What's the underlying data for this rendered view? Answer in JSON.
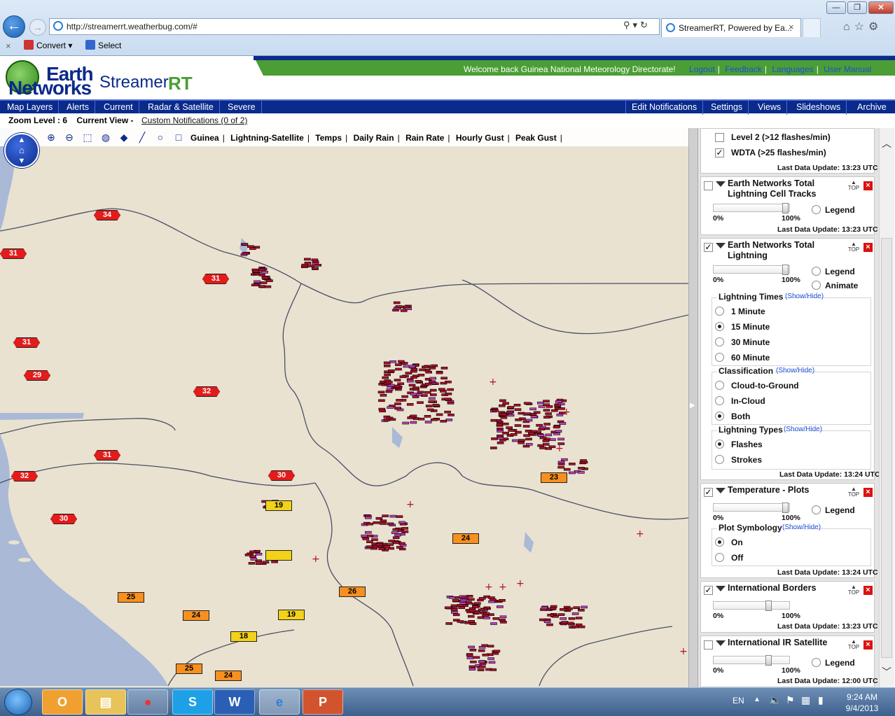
{
  "browser": {
    "url": "http://streamerrt.weatherbug.com/#",
    "tab_title": "StreamerRT, Powered by Ea...",
    "tab_close": "×",
    "cmd_close": "×",
    "convert_label": "Convert",
    "select_label": "Select",
    "window_buttons": [
      "—",
      "❐",
      "✕"
    ]
  },
  "header": {
    "logo_line1": "Earth",
    "logo_line2": "Networks",
    "logo_streamer": "Streamer",
    "logo_rt": "RT",
    "welcome": "Welcome back  Guinea National Meteorology Directorate!",
    "links": [
      "Logout",
      "Feedback",
      "Languages",
      "User Manual"
    ],
    "link_sep": "|"
  },
  "nav": {
    "left": [
      "Map Layers",
      "Alerts",
      "Current",
      "Radar & Satellite",
      "Severe"
    ],
    "right": [
      "Edit Notifications",
      "Settings",
      "Views",
      "Slideshows",
      "Archive"
    ]
  },
  "subnav": {
    "zoom_label": "Zoom Level : 6",
    "view_label": "Current View -",
    "custom_notifications": "Custom Notifications (0 of 2)"
  },
  "map": {
    "view_links": [
      "Guinea",
      "Lightning-Satellite",
      "Temps",
      "Daily Rain",
      "Rain Rate",
      "Hourly Gust",
      "Peak Gust"
    ],
    "view_sep": "|",
    "pan_up": "▲",
    "pan_down": "▼",
    "pan_home": "⌂",
    "temps": [
      {
        "v": "34",
        "c": "red"
      },
      {
        "v": "31",
        "c": "red"
      },
      {
        "v": "31",
        "c": "red"
      },
      {
        "v": "31",
        "c": "red"
      },
      {
        "v": "29",
        "c": "red"
      },
      {
        "v": "32",
        "c": "red"
      },
      {
        "v": "31",
        "c": "red"
      },
      {
        "v": "32",
        "c": "red"
      },
      {
        "v": "30",
        "c": "red"
      },
      {
        "v": "30",
        "c": "red"
      },
      {
        "v": "19",
        "c": "yellow"
      },
      {
        "v": "23",
        "c": "orange"
      },
      {
        "v": "24",
        "c": "orange"
      },
      {
        "v": "26",
        "c": "orange"
      },
      {
        "v": "25",
        "c": "orange"
      },
      {
        "v": "24",
        "c": "orange"
      },
      {
        "v": "19",
        "c": "yellow"
      },
      {
        "v": "18",
        "c": "yellow"
      },
      {
        "v": "25",
        "c": "orange"
      },
      {
        "v": "24",
        "c": "orange"
      },
      {
        "v": "",
        "c": "yellow"
      }
    ]
  },
  "panel": {
    "wdta": {
      "level2": "Level 2 (>12 flashes/min)",
      "wdta": "WDTA (>25 flashes/min)",
      "update": "Last Data Update:  13:23 UTC"
    },
    "cell_tracks": {
      "title1": "Earth Networks Total",
      "title2": "Lightning Cell Tracks",
      "top": "TOP",
      "x": "×",
      "pct0": "0%",
      "pct100": "100%",
      "legend": "Legend",
      "update": "Last Data Update:  13:23 UTC"
    },
    "lightning": {
      "title1": "Earth Networks Total",
      "title2": "Lightning",
      "top": "TOP",
      "x": "×",
      "pct0": "0%",
      "pct100": "100%",
      "legend": "Legend",
      "animate": "Animate",
      "times_label": "Lightning Times",
      "class_label": "Classification",
      "types_label": "Lightning Types",
      "showhide": "(Show/Hide)",
      "times": [
        "1 Minute",
        "15 Minute",
        "30 Minute",
        "60 Minute"
      ],
      "classes": [
        "Cloud-to-Ground",
        "In-Cloud",
        "Both"
      ],
      "types": [
        "Flashes",
        "Strokes"
      ],
      "update": "Last Data Update:  13:24 UTC"
    },
    "temp": {
      "title": "Temperature - Plots",
      "top": "TOP",
      "x": "×",
      "pct0": "0%",
      "pct100": "100%",
      "legend": "Legend",
      "symb_label": "Plot Symbology",
      "showhide": "(Show/Hide)",
      "on": "On",
      "off": "Off",
      "update": "Last Data Update:  13:24 UTC"
    },
    "borders": {
      "title": "International Borders",
      "top": "TOP",
      "x": "×",
      "pct0": "0%",
      "pct100": "100%",
      "update": "Last Data Update:  13:23 UTC"
    },
    "satellite": {
      "title": "International IR Satellite",
      "top": "TOP",
      "x": "×",
      "pct0": "0%",
      "pct100": "100%",
      "legend": "Legend",
      "update": "Last Data Update:  12:00 UTC"
    }
  },
  "taskbar": {
    "lang": "EN",
    "time": "9:24 AM",
    "date": "9/4/2013",
    "apps": [
      "O",
      "▤",
      "●",
      "S",
      "W",
      "e",
      "P"
    ]
  },
  "colors": {
    "nav_blue": "#0a2a8c",
    "header_green": "#4b9e35",
    "temp_red": "#e31b1b",
    "temp_orange": "#f7901e",
    "temp_yellow": "#f2d21a",
    "lightning": "#b0102a"
  }
}
